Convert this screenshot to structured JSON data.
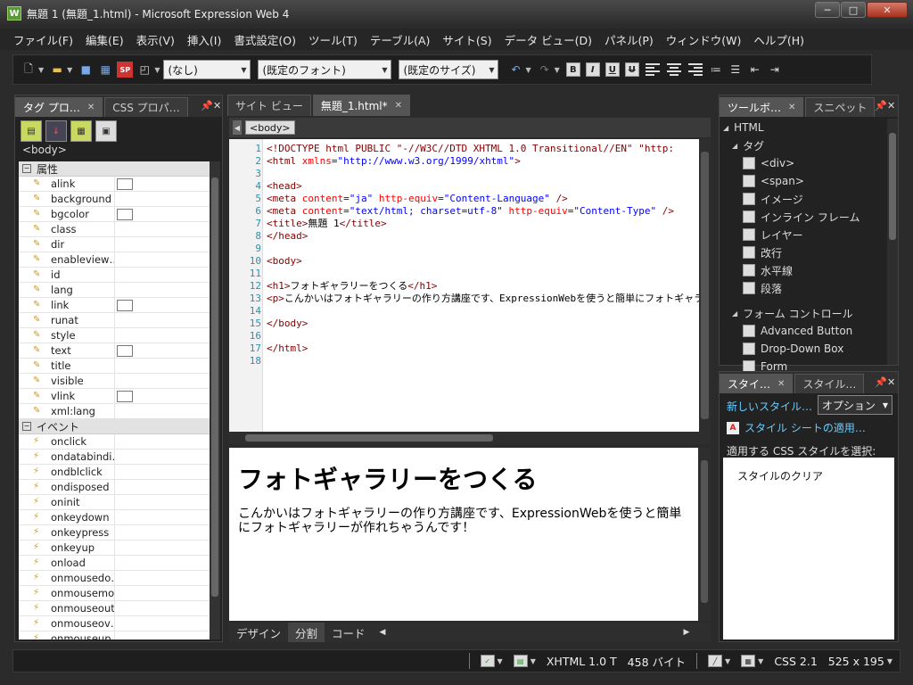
{
  "window": {
    "title": "無題 1 (無題_1.html) - Microsoft Expression Web 4",
    "app_icon": "W",
    "controls": {
      "minimize": "─",
      "maximize": "□",
      "close": "✕"
    }
  },
  "menu": [
    "ファイル(F)",
    "編集(E)",
    "表示(V)",
    "挿入(I)",
    "書式設定(O)",
    "ツール(T)",
    "テーブル(A)",
    "サイト(S)",
    "データ ビュー(D)",
    "パネル(P)",
    "ウィンドウ(W)",
    "ヘルプ(H)"
  ],
  "toolbar": {
    "style_combo": "(なし)",
    "font_combo": "(既定のフォント)",
    "size_combo": "(既定のサイズ)",
    "bold": "B",
    "italic": "I",
    "underline": "U",
    "strikethrough": "U"
  },
  "tag_panel": {
    "tabs": [
      "タグ プロ…",
      "CSS プロパ…"
    ],
    "selected_tag": "<body>",
    "categories": {
      "attributes": "属性",
      "events": "イベント"
    },
    "attributes": [
      "alink",
      "background",
      "bgcolor",
      "class",
      "dir",
      "enableview…",
      "id",
      "lang",
      "link",
      "runat",
      "style",
      "text",
      "title",
      "visible",
      "vlink",
      "xml:lang"
    ],
    "color_attributes": [
      "alink",
      "bgcolor",
      "link",
      "text",
      "vlink"
    ],
    "events": [
      "onclick",
      "ondatabindi…",
      "ondblclick",
      "ondisposed",
      "oninit",
      "onkeydown",
      "onkeypress",
      "onkeyup",
      "onload",
      "onmousedo…",
      "onmousemo…",
      "onmouseout",
      "onmouseov…",
      "onmouseup"
    ]
  },
  "editor": {
    "tabs": [
      "サイト ビュー",
      "無題_1.html*"
    ],
    "breadcrumb_tag": "<body>",
    "code_lines": [
      {
        "n": "1",
        "html": "<span class=\"tag\">&lt;!DOCTYPE html PUBLIC \"-//W3C//DTD XHTML 1.0 Transitional//EN\" \"http:</span>"
      },
      {
        "n": "2",
        "html": "<span class=\"tag\">&lt;html</span> <span class=\"attr\">xmlns</span>=<span class=\"val\">\"http://www.w3.org/1999/xhtml\"</span><span class=\"tag\">&gt;</span>"
      },
      {
        "n": "3",
        "html": ""
      },
      {
        "n": "4",
        "html": "<span class=\"tag\">&lt;head&gt;</span>"
      },
      {
        "n": "5",
        "html": "<span class=\"tag\">&lt;meta</span> <span class=\"attr\">content</span>=<span class=\"val\">\"ja\"</span> <span class=\"attr\">http-equiv</span>=<span class=\"val\">\"Content-Language\"</span> <span class=\"tag\">/&gt;</span>"
      },
      {
        "n": "6",
        "html": "<span class=\"tag\">&lt;meta</span> <span class=\"attr\">content</span>=<span class=\"val\">\"text/html; charset=utf-8\"</span> <span class=\"attr\">http-equiv</span>=<span class=\"val\">\"Content-Type\"</span> <span class=\"tag\">/&gt;</span>"
      },
      {
        "n": "7",
        "html": "<span class=\"tag\">&lt;title&gt;</span><span class=\"txt\">無題 1</span><span class=\"tag\">&lt;/title&gt;</span>"
      },
      {
        "n": "8",
        "html": "<span class=\"tag\">&lt;/head&gt;</span>"
      },
      {
        "n": "9",
        "html": ""
      },
      {
        "n": "10",
        "html": "<span class=\"tag\">&lt;body&gt;</span>"
      },
      {
        "n": "11",
        "html": ""
      },
      {
        "n": "12",
        "html": "<span class=\"tag\">&lt;h1&gt;</span><span class=\"txt\">フォトギャラリーをつくる</span><span class=\"tag\">&lt;/h1&gt;</span>"
      },
      {
        "n": "13",
        "html": "<span class=\"tag\">&lt;p&gt;</span><span class=\"txt\">こんかいはフォトギャラリーの作り方講座です、ExpressionWebを使うと簡単にフォトギャラリーが作れ</span>"
      },
      {
        "n": "14",
        "html": ""
      },
      {
        "n": "15",
        "html": "<span class=\"tag\">&lt;/body&gt;</span>"
      },
      {
        "n": "16",
        "html": ""
      },
      {
        "n": "17",
        "html": "<span class=\"tag\">&lt;/html&gt;</span>"
      },
      {
        "n": "18",
        "html": ""
      }
    ],
    "design": {
      "heading": "フォトギャラリーをつくる",
      "paragraph": "こんかいはフォトギャラリーの作り方講座です、ExpressionWebを使うと簡単にフォトギャラリーが作れちゃうんです！"
    },
    "view_tabs": [
      "デザイン",
      "分割",
      "コード"
    ],
    "active_view": "分割"
  },
  "toolbox": {
    "tabs": [
      "ツールボ…",
      "スニペット"
    ],
    "root": "HTML",
    "tags_group": "タグ",
    "tags": [
      {
        "label": "<div>",
        "icon": "div-icon"
      },
      {
        "label": "<span>",
        "icon": "span-icon"
      },
      {
        "label": "イメージ",
        "icon": "image-icon"
      },
      {
        "label": "インライン フレーム",
        "icon": "iframe-icon"
      },
      {
        "label": "レイヤー",
        "icon": "layer-icon"
      },
      {
        "label": "改行",
        "icon": "line-break-icon"
      },
      {
        "label": "水平線",
        "icon": "horizontal-rule-icon"
      },
      {
        "label": "段落",
        "icon": "paragraph-icon"
      }
    ],
    "form_group": "フォーム コントロール",
    "form_items": [
      {
        "label": "Advanced Button",
        "icon": "button-icon"
      },
      {
        "label": "Drop-Down Box",
        "icon": "dropdown-icon"
      },
      {
        "label": "Form",
        "icon": "form-icon"
      }
    ]
  },
  "styles": {
    "tabs": [
      "スタイ…",
      "スタイル…"
    ],
    "new_style": "新しいスタイル…",
    "options": "オプション",
    "attach": "スタイル シートの適用…",
    "select_label": "適用する CSS スタイルを選択:",
    "clear": "スタイルのクリア"
  },
  "status": {
    "doctype": "XHTML 1.0 T",
    "size": "458 バイト",
    "css": "CSS 2.1",
    "dimensions": "525 x 195"
  }
}
